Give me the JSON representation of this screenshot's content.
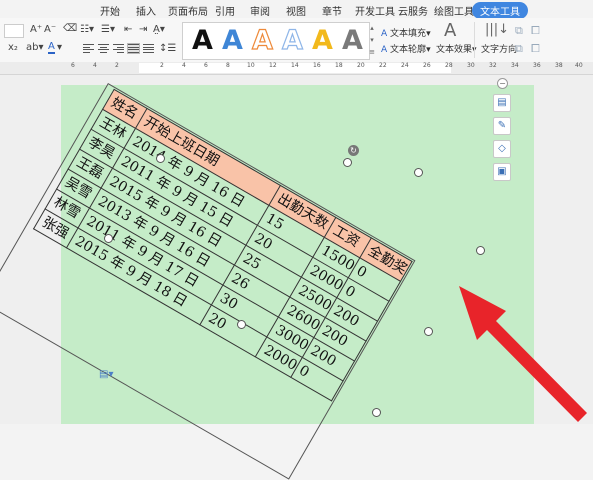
{
  "tabs": [
    "开始",
    "插入",
    "页面布局",
    "引用",
    "审阅",
    "视图",
    "章节",
    "开发工具",
    "云服务",
    "绘图工具",
    "文本工具"
  ],
  "active_tab": "文本工具",
  "toolbar": {
    "font_grow": "A⁺",
    "font_shrink": "A⁻",
    "fill_label": "文本填充",
    "outline_label": "文本轮廓",
    "effect_label": "文本效果",
    "direction_label": "文字方向",
    "art_letter": "A"
  },
  "art_colors": [
    "#111111",
    "#3f86d6",
    "#ee8a3a",
    "#8fb6e8",
    "#f2b91c",
    "#7a7a7a"
  ],
  "ruler_numbers": [
    "6",
    "4",
    "2",
    "",
    "2",
    "4",
    "6",
    "8",
    "10",
    "12",
    "14",
    "16",
    "18",
    "20",
    "22",
    "24",
    "26",
    "28",
    "30",
    "32",
    "34",
    "36",
    "38",
    "40",
    "42",
    "44",
    "46"
  ],
  "table": {
    "headers": [
      "姓名",
      "开始上班日期",
      "出勤天数",
      "工资",
      "全勤奖"
    ],
    "rows": [
      [
        "王林",
        "2014 年 9 月 16 日",
        "15",
        "1500",
        "0"
      ],
      [
        "李昊",
        "2011 年 9 月 15 日",
        "20",
        "2000",
        "0"
      ],
      [
        "王磊",
        "2015 年 9 月 16 日",
        "25",
        "2500",
        "200"
      ],
      [
        "吴雪",
        "2013 年 9 月 16 日",
        "26",
        "2600",
        "200"
      ],
      [
        "林雪",
        "2011 年 9 月 17 日",
        "30",
        "3000",
        "200"
      ],
      [
        "张强",
        "2015 年 9 月 18 日",
        "20",
        "2000",
        "0"
      ]
    ]
  },
  "colors": {
    "page_bg": "#c5ecc8",
    "header_bg": "#f9c3a8",
    "accent": "#3f86e0",
    "arrow": "#e8242a"
  }
}
